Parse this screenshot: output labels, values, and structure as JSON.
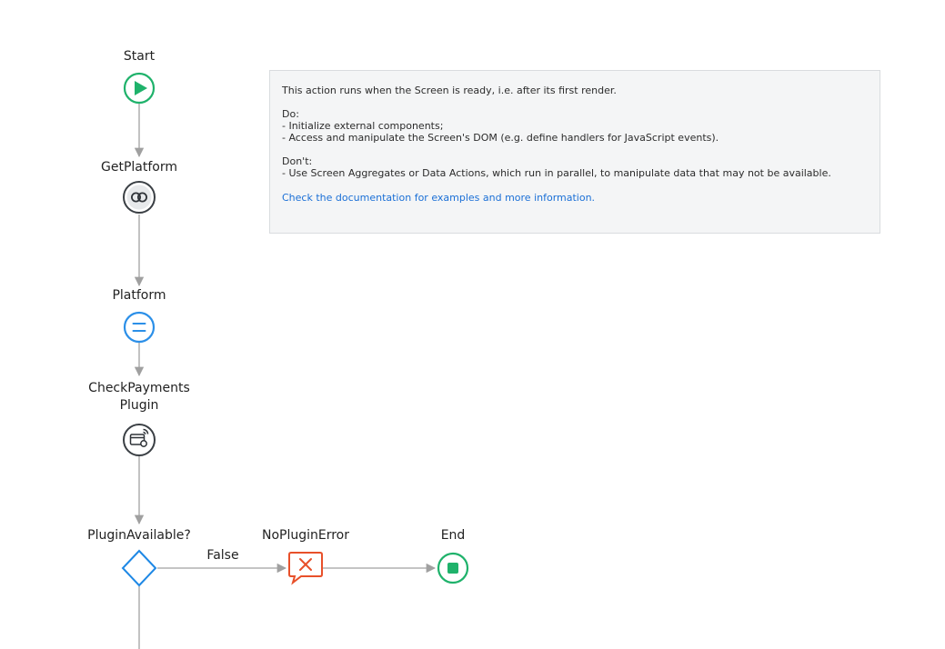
{
  "nodes": {
    "start": "Start",
    "get_platform": "GetPlatform",
    "platform": "Platform",
    "check_payments_line1": "CheckPayments",
    "check_payments_line2": "Plugin",
    "plugin_available": "PluginAvailable?",
    "no_plugin_error": "NoPluginError",
    "end": "End"
  },
  "edges": {
    "false_label": "False"
  },
  "note": {
    "line1": "This action runs when the Screen is ready, i.e. after its first render.",
    "do_title": "Do:",
    "do_1": "- Initialize external components;",
    "do_2": "- Access and manipulate the Screen's DOM (e.g. define handlers for JavaScript events).",
    "dont_title": "Don't:",
    "dont_1": "- Use Screen Aggregates or Data Actions, which run in parallel, to manipulate data that may not be available.",
    "link": "Check the documentation for examples and more information."
  },
  "colors": {
    "start": "#1fb26b",
    "assign": "#2b8fe8",
    "decision": "#1e88e5",
    "error": "#e8502a",
    "end": "#1fb26b",
    "connector": "#a0a0a0",
    "link": "#1a6fd6"
  }
}
